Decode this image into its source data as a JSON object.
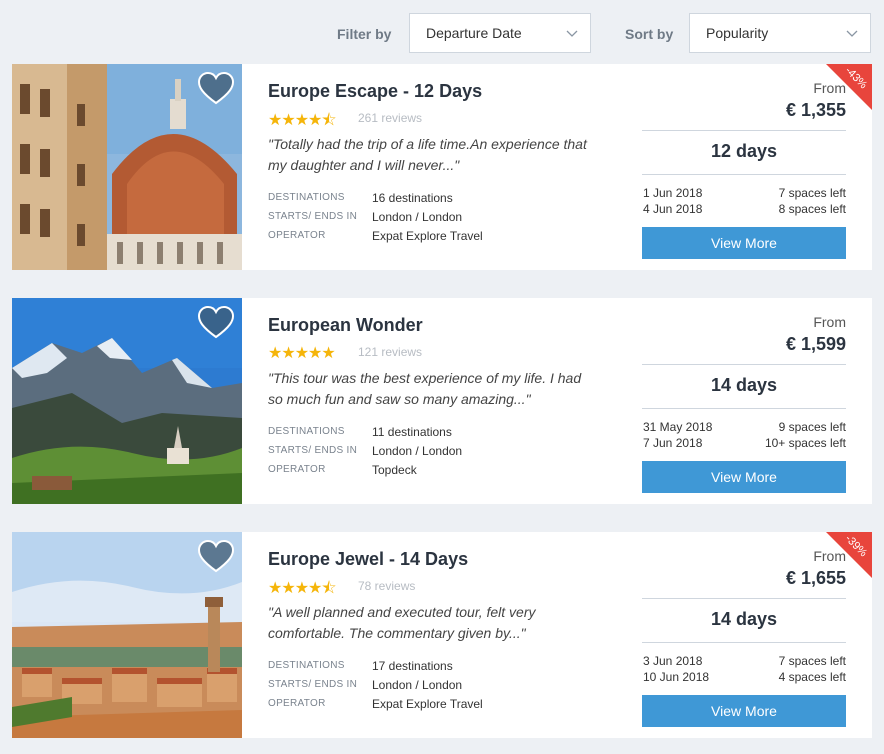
{
  "filters": {
    "filter_label": "Filter by",
    "filter_value": "Departure Date",
    "sort_label": "Sort by",
    "sort_value": "Popularity"
  },
  "tours": [
    {
      "title": "Europe Escape - 12 Days",
      "rating": 4.5,
      "stars": "★★★★⯪",
      "reviews": "261 reviews",
      "quote": "\"Totally had the trip of a life time.An experience that my daughter and I will never...\"",
      "destinations_label": "DESTINATIONS",
      "destinations": "16 destinations",
      "starts_label": "STARTS/ ENDS IN",
      "starts": "London / London",
      "operator_label": "OPERATOR",
      "operator": "Expat Explore Travel",
      "from_label": "From",
      "price": "€ 1,355",
      "discount": "-43%",
      "duration": "12 days",
      "departures": [
        {
          "date": "1 Jun 2018",
          "spaces": "7 spaces left"
        },
        {
          "date": "4 Jun 2018",
          "spaces": "8 spaces left"
        }
      ],
      "button": "View More"
    },
    {
      "title": "European Wonder",
      "rating": 5,
      "stars": "★★★★★",
      "reviews": "121 reviews",
      "quote": "\"This tour was the best experience of my life. I had so much fun and saw so many amazing...\"",
      "destinations_label": "DESTINATIONS",
      "destinations": "11 destinations",
      "starts_label": "STARTS/ ENDS IN",
      "starts": "London / London",
      "operator_label": "OPERATOR",
      "operator": "Topdeck",
      "from_label": "From",
      "price": "€ 1,599",
      "discount": "",
      "duration": "14 days",
      "departures": [
        {
          "date": "31 May 2018",
          "spaces": "9 spaces left"
        },
        {
          "date": "7 Jun 2018",
          "spaces": "10+ spaces left"
        }
      ],
      "button": "View More"
    },
    {
      "title": "Europe Jewel - 14 Days",
      "rating": 4.5,
      "stars": "★★★★⯪",
      "reviews": "78 reviews",
      "quote": "\"A well planned and executed tour, felt very comfortable. The commentary given by...\"",
      "destinations_label": "DESTINATIONS",
      "destinations": "17 destinations",
      "starts_label": "STARTS/ ENDS IN",
      "starts": "London / London",
      "operator_label": "OPERATOR",
      "operator": "Expat Explore Travel",
      "from_label": "From",
      "price": "€ 1,655",
      "discount": "-39%",
      "duration": "14 days",
      "departures": [
        {
          "date": "3 Jun 2018",
          "spaces": "7 spaces left"
        },
        {
          "date": "10 Jun 2018",
          "spaces": "4 spaces left"
        }
      ],
      "button": "View More"
    }
  ],
  "icons": {
    "heart": "heart-icon",
    "chevron": "chevron-down-icon",
    "star": "star-icon"
  },
  "colors": {
    "accent": "#3f98d6",
    "badge": "#e8453c",
    "star": "#f5b50a",
    "heart": "#3e5a72"
  }
}
